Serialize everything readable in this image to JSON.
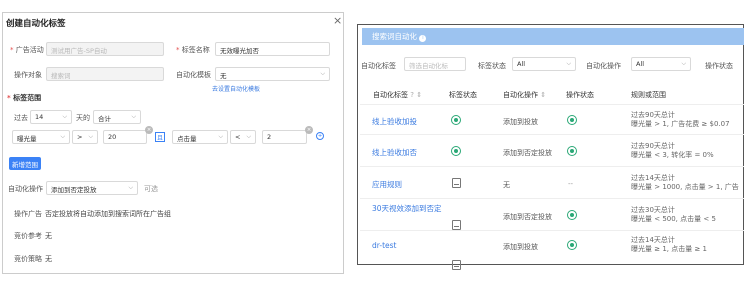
{
  "left": {
    "title": "创建自动化标签",
    "close": "×",
    "ad_activity": {
      "label": "广告活动",
      "placeholder": "测试用广告-SP自动"
    },
    "tag_name": {
      "label": "标签名称",
      "value": "无效曝光加否"
    },
    "operate_target": {
      "label": "操作对象",
      "placeholder": "搜索词"
    },
    "auto_template": {
      "label": "自动化模板",
      "value": "无"
    },
    "template_link": "去设置自动化模板",
    "range": {
      "label": "标签范围",
      "past": "过去",
      "days": "14",
      "day_suffix": "天的",
      "agg": "合计"
    },
    "cond1": {
      "metric": "曝光量",
      "op": ">",
      "value": "20"
    },
    "logic": "且",
    "cond2": {
      "metric": "点击量",
      "op": "<",
      "value": "2"
    },
    "add_range": "新增范围",
    "auto_op": {
      "label": "自动化操作",
      "value": "添加到否定投放",
      "optional": "可选"
    },
    "op_ad": {
      "label": "操作广告",
      "value": "否定投放将自动添加到搜索词所在广告组"
    },
    "bid_ref": {
      "label": "竞价参考",
      "value": "无"
    },
    "bid_strategy": {
      "label": "竞价策略",
      "value": "无"
    }
  },
  "right": {
    "banner": "搜索词自动化",
    "filters": {
      "tag_label": "自动化标签",
      "tag_placeholder": "筛选自动化标",
      "status_label": "标签状态",
      "status_value": "All",
      "op_label": "自动化操作",
      "op_value": "All",
      "op_status_label": "操作状态"
    },
    "columns": [
      "自动化标签",
      "标签状态",
      "自动化操作",
      "操作状态",
      "规则或范围"
    ],
    "rows": [
      {
        "tag": "线上验收加投",
        "op": "添加到投放",
        "op_status": "",
        "rule1": "过去90天总计",
        "rule2": "曝光量 > 1, 广告花费 ≥ $0.07"
      },
      {
        "tag": "线上验收加否",
        "op": "添加到否定投放",
        "op_status": "",
        "rule1": "过去90天总计",
        "rule2": "曝光量 < 3, 转化率 = 0%"
      },
      {
        "tag": "应用规则",
        "op": "无",
        "op_status": "--",
        "rule1": "过去14天总计",
        "rule2": "曝光量 > 1000, 点击量 > 1, 广告"
      },
      {
        "tag": "30天视效添加到否定",
        "op": "添加到否定投放",
        "op_status": "",
        "rule1": "过去30天总计",
        "rule2": "曝光量 < 500, 点击量 < 5"
      },
      {
        "tag": "dr-test",
        "op": "添加到投放",
        "op_status": "",
        "rule1": "过去14天总计",
        "rule2": "曝光量 ≥ 1, 点击量 ≥ 1"
      }
    ]
  }
}
